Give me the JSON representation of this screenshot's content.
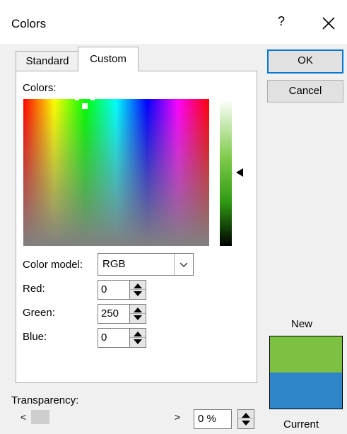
{
  "window": {
    "title": "Colors",
    "help_label": "?"
  },
  "tabs": [
    {
      "label": "Standard",
      "selected": false
    },
    {
      "label": "Custom",
      "selected": true
    }
  ],
  "custom": {
    "colors_label": "Colors:",
    "color_model_label": "Color model:",
    "color_model_value": "RGB",
    "red_label": "Red:",
    "red_value": "0",
    "green_label": "Green:",
    "green_value": "250",
    "blue_label": "Blue:",
    "blue_value": "0"
  },
  "buttons": {
    "ok": "OK",
    "cancel": "Cancel"
  },
  "preview": {
    "new_label": "New",
    "current_label": "Current",
    "new_color": "#7dc142",
    "current_color": "#2e86c9"
  },
  "transparency": {
    "label": "Transparency:",
    "value": "0 %"
  }
}
